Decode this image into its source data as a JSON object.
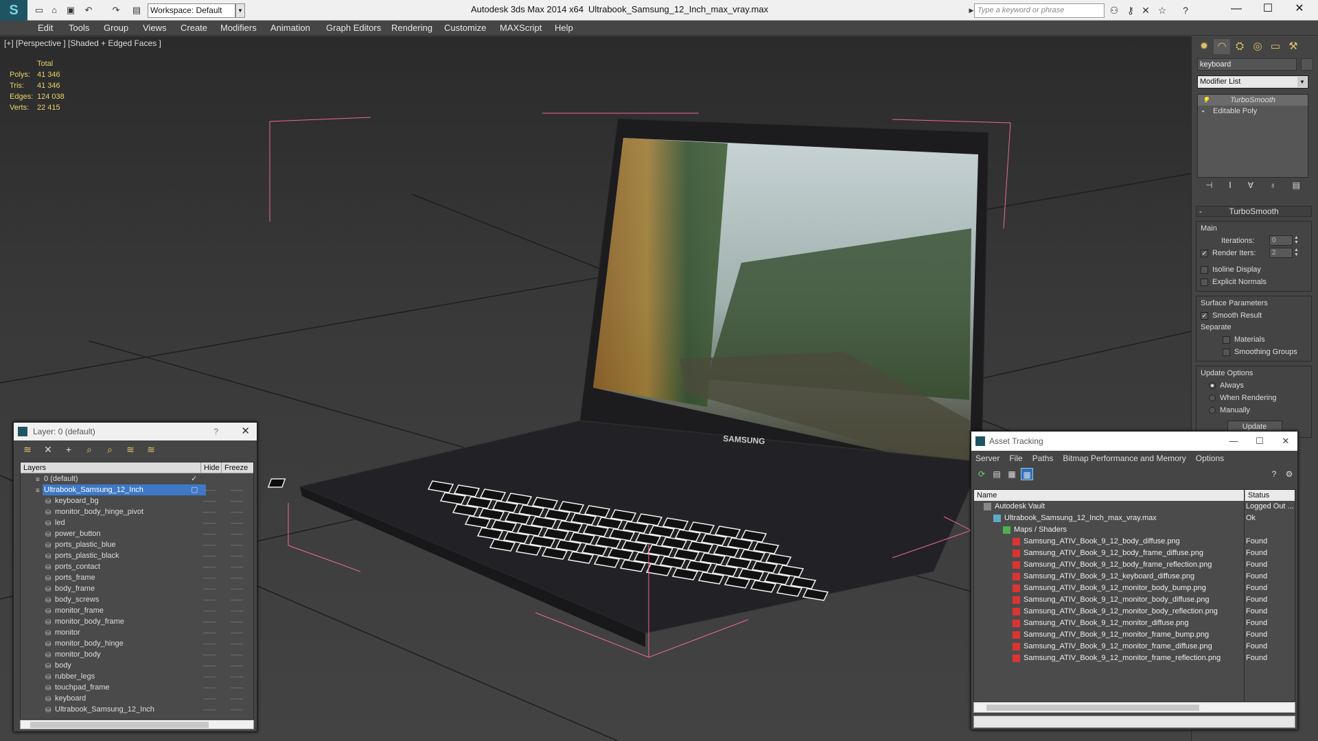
{
  "titlebar": {
    "app_title": "Autodesk 3ds Max  2014 x64",
    "file_title": "Ultrabook_Samsung_12_Inch_max_vray.max",
    "workspace": "Workspace: Default",
    "search_placeholder": "Type a keyword or phrase"
  },
  "menu": [
    "Edit",
    "Tools",
    "Group",
    "Views",
    "Create",
    "Modifiers",
    "Animation",
    "Graph Editors",
    "Rendering",
    "Customize",
    "MAXScript",
    "Help"
  ],
  "viewport": {
    "label": "[+] [Perspective ] [Shaded + Edged Faces ]",
    "stats": {
      "header": "Total",
      "rows": [
        {
          "k": "Polys:",
          "v": "41 346"
        },
        {
          "k": "Tris:",
          "v": "41 346"
        },
        {
          "k": "Edges:",
          "v": "124 038"
        },
        {
          "k": "Verts:",
          "v": "22 415"
        }
      ]
    },
    "brand": "SAMSUNG"
  },
  "command_panel": {
    "object_name": "keyboard",
    "modifier_list": "Modifier List",
    "stack": [
      "TurboSmooth",
      "Editable Poly"
    ],
    "rollout_title": "TurboSmooth",
    "main_label": "Main",
    "iterations_label": "Iterations:",
    "iterations_value": "0",
    "render_iters_label": "Render Iters:",
    "render_iters_value": "2",
    "isoline": "Isoline Display",
    "explicit": "Explicit Normals",
    "surface_label": "Surface Parameters",
    "smooth_result": "Smooth Result",
    "separate_label": "Separate",
    "materials": "Materials",
    "smoothing_groups": "Smoothing Groups",
    "update_label": "Update Options",
    "always": "Always",
    "when_rendering": "When Rendering",
    "manually": "Manually",
    "update_button": "Update"
  },
  "layer_window": {
    "title": "Layer: 0 (default)",
    "help": "?",
    "col_layers": "Layers",
    "col_hide": "Hide",
    "col_freeze": "Freeze",
    "layers": [
      {
        "name": "0 (default)",
        "type": "layer",
        "checked": true
      },
      {
        "name": "Ultrabook_Samsung_12_Inch",
        "type": "layer",
        "selected": true
      }
    ],
    "objects": [
      "keyboard_bg",
      "monitor_body_hinge_pivot",
      "led",
      "power_button",
      "ports_plastic_blue",
      "ports_plastic_black",
      "ports_contact",
      "ports_frame",
      "body_frame",
      "body_screws",
      "monitor_frame",
      "monitor_body_frame",
      "monitor",
      "monitor_body_hinge",
      "monitor_body",
      "body",
      "rubber_legs",
      "touchpad_frame",
      "keyboard",
      "Ultrabook_Samsung_12_Inch"
    ]
  },
  "asset_window": {
    "title": "Asset Tracking",
    "menu": [
      "Server",
      "File",
      "Paths",
      "Bitmap Performance and Memory",
      "Options"
    ],
    "col_name": "Name",
    "col_status": "Status",
    "rows": [
      {
        "name": "Autodesk Vault",
        "status": "Logged Out ...",
        "level": 0,
        "icon": "vault"
      },
      {
        "name": "Ultrabook_Samsung_12_Inch_max_vray.max",
        "status": "Ok",
        "level": 1,
        "icon": "max"
      },
      {
        "name": "Maps / Shaders",
        "status": "",
        "level": 2,
        "icon": "folder"
      },
      {
        "name": "Samsung_ATIV_Book_9_12_body_diffuse.png",
        "status": "Found",
        "level": 3,
        "icon": "png"
      },
      {
        "name": "Samsung_ATIV_Book_9_12_body_frame_diffuse.png",
        "status": "Found",
        "level": 3,
        "icon": "png"
      },
      {
        "name": "Samsung_ATIV_Book_9_12_body_frame_reflection.png",
        "status": "Found",
        "level": 3,
        "icon": "png"
      },
      {
        "name": "Samsung_ATIV_Book_9_12_keyboard_diffuse.png",
        "status": "Found",
        "level": 3,
        "icon": "png"
      },
      {
        "name": "Samsung_ATIV_Book_9_12_monitor_body_bump.png",
        "status": "Found",
        "level": 3,
        "icon": "png"
      },
      {
        "name": "Samsung_ATIV_Book_9_12_monitor_body_diffuse.png",
        "status": "Found",
        "level": 3,
        "icon": "png"
      },
      {
        "name": "Samsung_ATIV_Book_9_12_monitor_body_reflection.png",
        "status": "Found",
        "level": 3,
        "icon": "png"
      },
      {
        "name": "Samsung_ATIV_Book_9_12_monitor_diffuse.png",
        "status": "Found",
        "level": 3,
        "icon": "png"
      },
      {
        "name": "Samsung_ATIV_Book_9_12_monitor_frame_bump.png",
        "status": "Found",
        "level": 3,
        "icon": "png"
      },
      {
        "name": "Samsung_ATIV_Book_9_12_monitor_frame_diffuse.png",
        "status": "Found",
        "level": 3,
        "icon": "png"
      },
      {
        "name": "Samsung_ATIV_Book_9_12_monitor_frame_reflection.png",
        "status": "Found",
        "level": 3,
        "icon": "png"
      }
    ]
  }
}
